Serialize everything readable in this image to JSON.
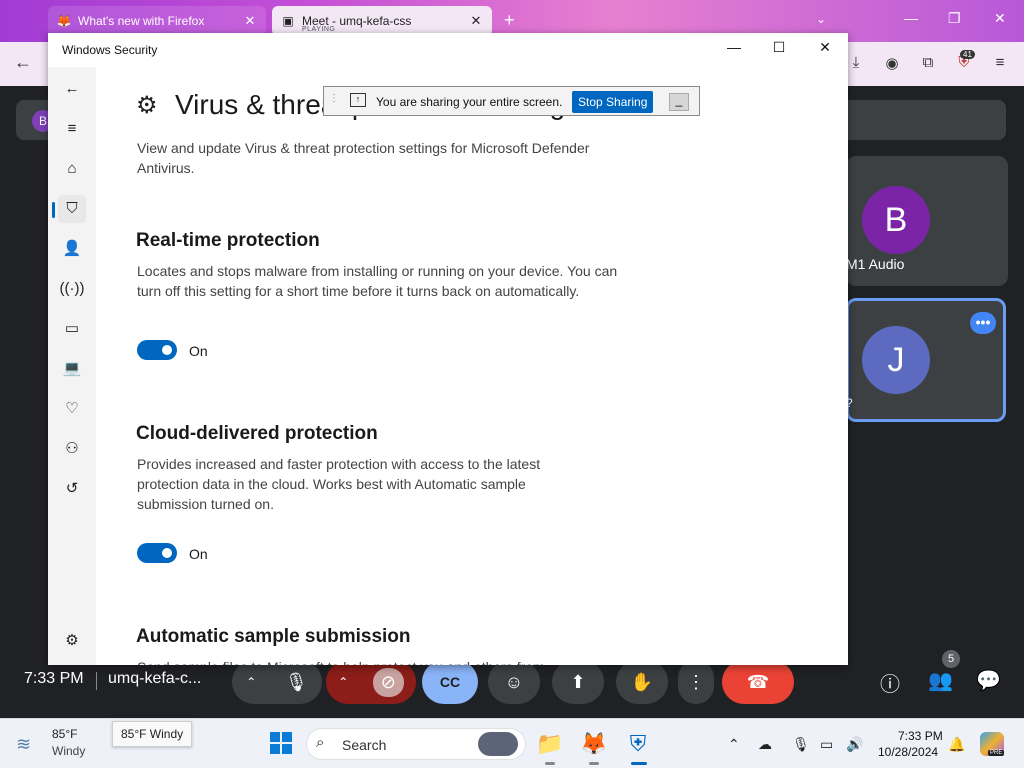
{
  "firefox": {
    "tab1_title": "What's new with Firefox",
    "tab2_title": "Meet - umq-kefa-css",
    "tab2_subtitle": "PLAYING",
    "extension_badge": "41"
  },
  "meet": {
    "pill_avatar": "B",
    "tile1_avatar": "B",
    "tile1_label": "M1 Audio",
    "tile2_avatar": "J",
    "tile2_label": "?",
    "time": "7:33 PM",
    "meeting_code": "umq-kefa-c...",
    "participants_count": "5",
    "accent_color": "#8ab4f8",
    "end_call_color": "#ea4335"
  },
  "security_window": {
    "title": "Windows Security",
    "page_heading": "Virus & threat protection settings",
    "page_description": "View and update Virus & threat protection settings for Microsoft Defender Antivirus.",
    "sections": [
      {
        "heading": "Real-time protection",
        "description": "Locates and stops malware from installing or running on your device. You can turn off this setting for a short time before it turns back on automatically.",
        "toggle_state": "On"
      },
      {
        "heading": "Cloud-delivered protection",
        "description": "Provides increased and faster protection with access to the latest protection data in the cloud. Works best with Automatic sample submission turned on.",
        "toggle_state": "On"
      },
      {
        "heading": "Automatic sample submission",
        "description": "Send sample files to Microsoft to help protect you and others from"
      }
    ],
    "accent_color": "#0067c0"
  },
  "share_bar": {
    "message": "You are sharing your entire screen.",
    "stop_label": "Stop Sharing"
  },
  "taskbar": {
    "weather_temp": "85°F",
    "weather_condition": "Windy",
    "weather_tooltip": "85°F Windy",
    "search_placeholder": "Search",
    "time": "7:33 PM",
    "date": "10/28/2024",
    "copilot_badge": "PRE"
  }
}
